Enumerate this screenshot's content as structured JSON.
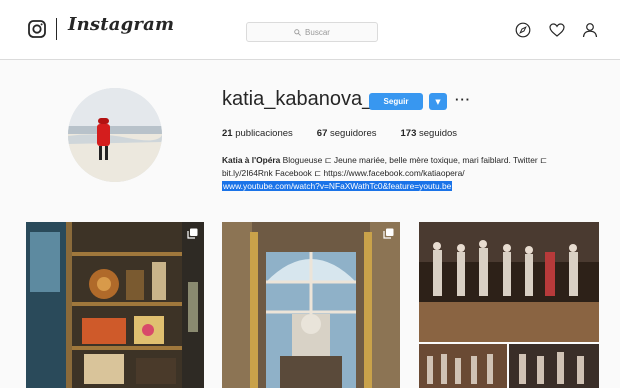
{
  "header": {
    "brand": "Instagram",
    "search_placeholder": "Buscar"
  },
  "icons": {
    "logo": "camera-logo-icon",
    "search": "search-icon",
    "explore": "compass-icon",
    "activity": "heart-icon",
    "profile": "person-icon",
    "multi_post": "multiple-images-icon"
  },
  "profile": {
    "username": "katia_kabanova_",
    "follow_label": "Seguir",
    "stats": [
      {
        "value": "21",
        "label": "publicaciones"
      },
      {
        "value": "67",
        "label": "seguidores"
      },
      {
        "value": "173",
        "label": "seguidos"
      }
    ],
    "bio_name": "Katia à l'Opéra",
    "bio_line1": "Blogueuse ⊏ Jeune mariée, belle mère toxique, mari faiblard. Twitter ⊏",
    "bio_line2": "bit.ly/2I64Rnk Facebook ⊏ https://www.facebook.com/katiaopera/",
    "bio_link": "www.youtube.com/watch?v=NFaXWathTc0&feature=youtu.be"
  },
  "colors": {
    "accent": "#3897f0",
    "selection": "#1a73e8",
    "border": "#dbdbdb",
    "background": "#fafafa"
  },
  "posts": [
    {
      "kind": "shop interior with wooden shelves and curios",
      "multiple": true
    },
    {
      "kind": "palace window with bust statue",
      "multiple": true
    },
    {
      "kind": "stage rehearsal collage",
      "multiple": false
    }
  ]
}
